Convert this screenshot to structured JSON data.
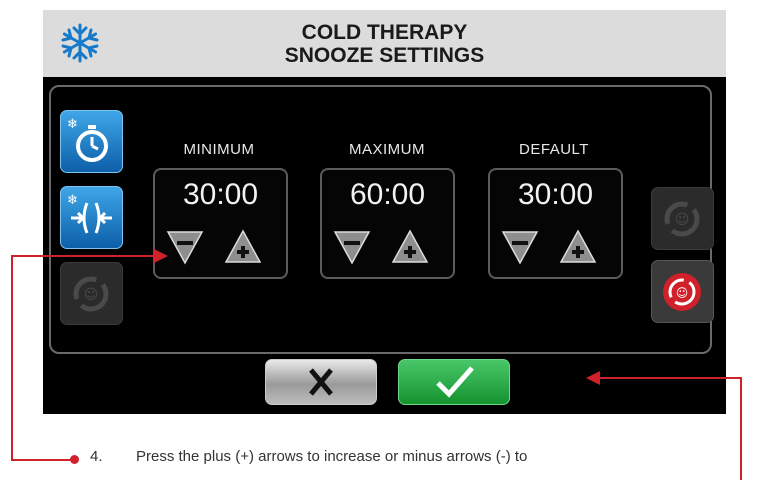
{
  "header": {
    "title_line1": "COLD THERAPY",
    "title_line2": "SNOOZE SETTINGS",
    "logo_icon": "snowflake-icon"
  },
  "side_buttons_left": [
    {
      "icon": "cold-timer-icon",
      "state": "active"
    },
    {
      "icon": "cold-compress-icon",
      "state": "active"
    },
    {
      "icon": "snooze-cycle-icon",
      "state": "disabled"
    }
  ],
  "side_buttons_right": [
    {
      "icon": "snooze-cycle-icon",
      "state": "disabled"
    },
    {
      "icon": "snooze-cycle-icon",
      "state": "active-red"
    }
  ],
  "settings": [
    {
      "label": "MINIMUM",
      "value": "30:00"
    },
    {
      "label": "MAXIMUM",
      "value": "60:00"
    },
    {
      "label": "DEFAULT",
      "value": "30:00"
    }
  ],
  "actions": {
    "cancel_icon": "close-icon",
    "confirm_icon": "checkmark-icon"
  },
  "callout": {
    "number": "4.",
    "text": "Press the plus (+) arrows to increase or minus arrows (-) to"
  },
  "colors": {
    "accent_blue": "#1b7fd0",
    "confirm_green": "#2fb14a",
    "callout_red": "#d0202a"
  }
}
